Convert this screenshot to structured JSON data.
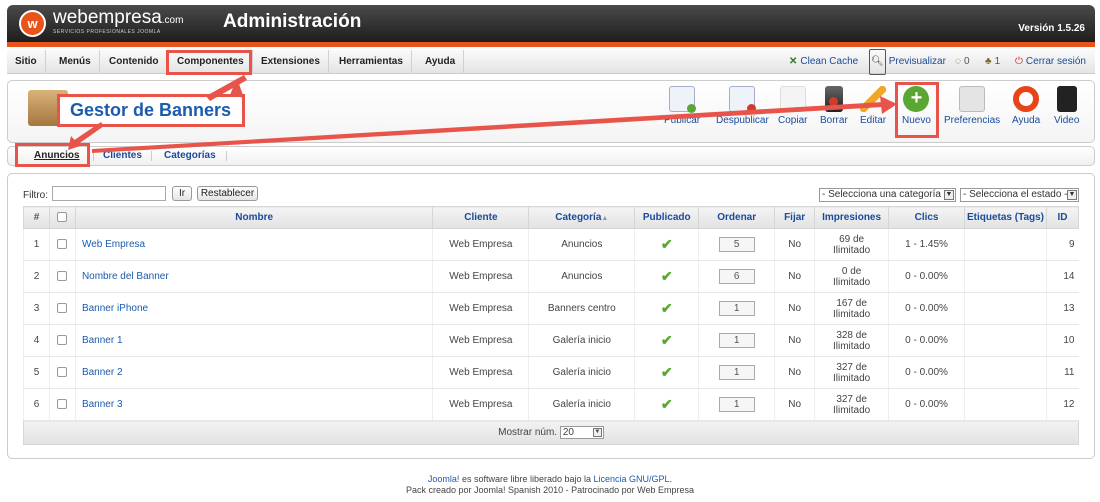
{
  "header": {
    "logo_text": "webempresa",
    "logo_suffix": ".com",
    "logo_subtitle": "SERVICIOS PROFESIONALES JOOMLA",
    "logo_letter": "w",
    "title": "Administración",
    "version": "Versión 1.5.26"
  },
  "menu": {
    "items": [
      "Sitio",
      "Menús",
      "Contenido",
      "Componentes",
      "Extensiones",
      "Herramientas",
      "Ayuda"
    ]
  },
  "status": {
    "clean_cache": "Clean Cache",
    "preview": "Previsualizar",
    "messages_count": "0",
    "users_count": "1",
    "logout": "Cerrar sesión"
  },
  "page": {
    "title": "Gestor de Banners"
  },
  "toolbar": {
    "buttons": [
      "Publicar",
      "Despublicar",
      "Copiar",
      "Borrar",
      "Editar",
      "Nuevo",
      "Preferencias",
      "Ayuda",
      "Video"
    ]
  },
  "tabs": [
    "Anuncios",
    "Clientes",
    "Categorías"
  ],
  "filter": {
    "label": "Filtro:",
    "value": "",
    "go_label": "Ir",
    "reset_label": "Restablecer",
    "category_select": "- Selecciona una categoría -",
    "state_select": "- Selecciona el estado -"
  },
  "table": {
    "headers": [
      "#",
      "Nombre",
      "Cliente",
      "Categoría",
      "Publicado",
      "Ordenar",
      "Fijar",
      "Impresiones",
      "Clics",
      "Etiquetas (Tags)",
      "ID"
    ],
    "rows": [
      {
        "num": "1",
        "name": "Web Empresa",
        "client": "Web Empresa",
        "category": "Anuncios",
        "order": "5",
        "fixed": "No",
        "impressions": "69 de",
        "impressions2": "Ilimitado",
        "clicks": "1 - 1.45%",
        "tags": "",
        "id": "9"
      },
      {
        "num": "2",
        "name": "Nombre del Banner",
        "client": "Web Empresa",
        "category": "Anuncios",
        "order": "6",
        "fixed": "No",
        "impressions": "0 de",
        "impressions2": "Ilimitado",
        "clicks": "0 - 0.00%",
        "tags": "",
        "id": "14"
      },
      {
        "num": "3",
        "name": "Banner iPhone",
        "client": "Web Empresa",
        "category": "Banners centro",
        "order": "1",
        "fixed": "No",
        "impressions": "167 de",
        "impressions2": "Ilimitado",
        "clicks": "0 - 0.00%",
        "tags": "",
        "id": "13"
      },
      {
        "num": "4",
        "name": "Banner 1",
        "client": "Web Empresa",
        "category": "Galería inicio",
        "order": "1",
        "fixed": "No",
        "impressions": "328 de",
        "impressions2": "Ilimitado",
        "clicks": "0 - 0.00%",
        "tags": "",
        "id": "10"
      },
      {
        "num": "5",
        "name": "Banner 2",
        "client": "Web Empresa",
        "category": "Galería inicio",
        "order": "1",
        "fixed": "No",
        "impressions": "327 de",
        "impressions2": "Ilimitado",
        "clicks": "0 - 0.00%",
        "tags": "",
        "id": "11"
      },
      {
        "num": "6",
        "name": "Banner 3",
        "client": "Web Empresa",
        "category": "Galería inicio",
        "order": "1",
        "fixed": "No",
        "impressions": "327 de",
        "impressions2": "Ilimitado",
        "clicks": "0 - 0.00%",
        "tags": "",
        "id": "12"
      }
    ],
    "pagination_label": "Mostrar núm.",
    "pagination_value": "20"
  },
  "footer": {
    "line1_a": "Joomla!",
    "line1_b": " es software libre liberado bajo la ",
    "line1_c": "Licencia GNU/GPL",
    "line1_d": ".",
    "line2": "Pack creado por Joomla! Spanish 2010 - Patrocinado por Web Empresa"
  },
  "colors": {
    "accent": "#e8541a",
    "highlight": "#e8544a",
    "link": "#1a5cae",
    "check": "#5aa632"
  }
}
